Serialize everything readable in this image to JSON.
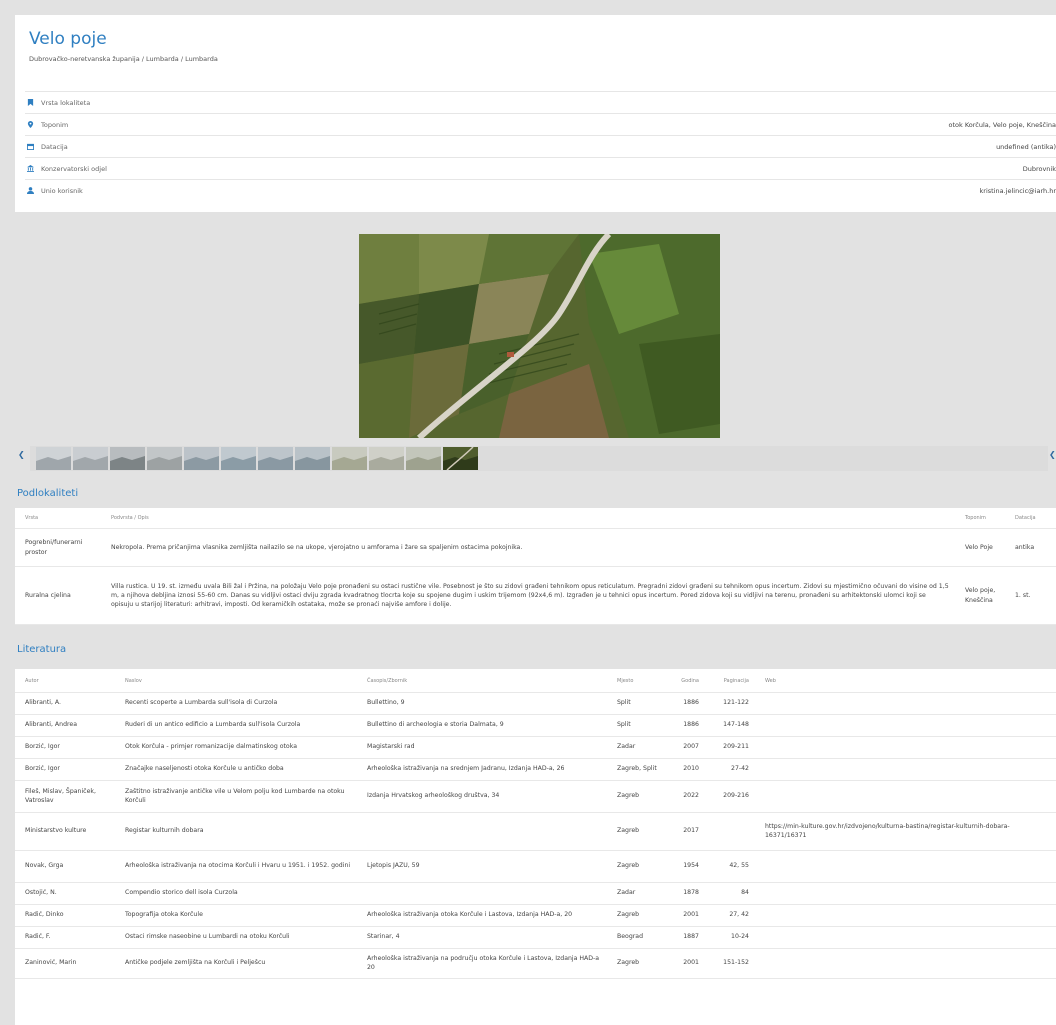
{
  "site": {
    "title": "Velo poje",
    "breadcrumb": "Dubrovačko-neretvanska županija / Lumbarda / Lumbarda"
  },
  "info": [
    {
      "icon": "bookmark-icon",
      "label": "Vrsta lokaliteta",
      "value": ""
    },
    {
      "icon": "map-marker-icon",
      "label": "Toponim",
      "value": "otok Korčula, Velo poje, Kneščina"
    },
    {
      "icon": "calendar-icon",
      "label": "Datacija",
      "value": "undefined (antika)"
    },
    {
      "icon": "institution-icon",
      "label": "Konzervatorski odjel",
      "value": "Dubrovnik"
    },
    {
      "icon": "user-icon",
      "label": "Unio korisnik",
      "value": "kristina.jelincic@iarh.hr"
    }
  ],
  "colors": {
    "accent": "#2f7fc1",
    "background": "#e2e2e2"
  },
  "gallery": {
    "prev_icon": "chevron-left-icon",
    "next_icon": "chevron-right-icon",
    "nav_prev": "❮",
    "nav_next": "❮",
    "thumb_count": 12
  },
  "sections": {
    "subsites": "Podlokaliteti",
    "literature": "Literatura"
  },
  "subsites": {
    "columns": [
      "Vrsta",
      "Podvrsta / Opis",
      "Toponim",
      "Datacija"
    ],
    "rows": [
      {
        "type": "Pogrebni/funerarni prostor",
        "description": "Nekropola. Prema pričanjima vlasnika zemljišta nailazilo se na ukope, vjerojatno u amforama i žare sa spaljenim ostacima pokojnika.",
        "toponym": "Velo Poje",
        "dating": "antika"
      },
      {
        "type": "Ruralna cjelina",
        "description": "Villa rustica. U 19. st. između uvala Bili žal i Pržina, na položaju Velo poje pronađeni su ostaci rustične vile. Posebnost je što su zidovi građeni tehnikom opus reticulatum. Pregradni zidovi građeni su tehnikom opus incertum. Zidovi su mjestimično očuvani do visine od 1,5 m, a njihova debljina iznosi 55-60 cm. Danas su vidljivi ostaci dviju zgrada kvadratnog tlocrta koje su spojene dugim i uskim trijemom (92x4,6 m). Izgrađen je u tehnici opus incertum. Pored zidova koji su vidljivi na terenu, pronađeni su arhitektonski ulomci koji se opisuju u starijoj literaturi: arhitravi, imposti. Od keramičkih ostataka, može se pronaći najviše amfore i dolije.",
        "toponym": "Velo poje, Kneščina",
        "dating": "1. st."
      }
    ]
  },
  "literature": {
    "columns": [
      "Autor",
      "Naslov",
      "Časopis/Zbornik",
      "Mjesto",
      "Godina",
      "Paginacija",
      "Web"
    ],
    "rows": [
      {
        "author": "Alibranti, A.",
        "title": "Recenti scoperte a Lumbarda sull'isola di Curzola",
        "journal": "Bullettino, 9",
        "place": "Split",
        "year": "1886",
        "pages": "121-122",
        "web": ""
      },
      {
        "author": "Alibranti, Andrea",
        "title": "Ruderi di un antico edificio a Lumbarda sull'isola Curzola",
        "journal": "Bullettino di archeologia e storia Dalmata, 9",
        "place": "Split",
        "year": "1886",
        "pages": "147-148",
        "web": ""
      },
      {
        "author": "Borzić, Igor",
        "title": "Otok Korčula - primjer romanizacije dalmatinskog otoka",
        "journal": "Magistarski rad",
        "place": "Zadar",
        "year": "2007",
        "pages": "209-211",
        "web": ""
      },
      {
        "author": "Borzić, Igor",
        "title": "Značajke naseljenosti otoka Korčule u antičko doba",
        "journal": "Arheološka istraživanja na srednjem Jadranu, Izdanja HAD-a, 26",
        "place": "Zagreb, Split",
        "year": "2010",
        "pages": "27-42",
        "web": ""
      },
      {
        "author": "Fileš, Mislav, Španiček, Vatroslav",
        "title": "Zaštitno istraživanje antičke vile u Velom polju kod Lumbarde na otoku Korčuli",
        "journal": "Izdanja Hrvatskog arheološkog društva, 34",
        "place": "Zagreb",
        "year": "2022",
        "pages": "209-216",
        "web": ""
      },
      {
        "author": "Ministarstvo kulture",
        "title": "Registar kulturnih dobara",
        "journal": "",
        "place": "Zagreb",
        "year": "2017",
        "pages": "",
        "web": "https://min-kulture.gov.hr/izdvojeno/kulturna-bastina/registar-kulturnih-dobara-16371/16371"
      },
      {
        "author": "Novak, Grga",
        "title": "Arheološka istraživanja na otocima Korčuli i Hvaru u 1951. i 1952. godini",
        "journal": "Ljetopis JAZU, 59",
        "place": "Zagreb",
        "year": "1954",
        "pages": "42, 55",
        "web": ""
      },
      {
        "author": "Ostojić, N.",
        "title": "Compendio storico dell isola Curzola",
        "journal": "",
        "place": "Zadar",
        "year": "1878",
        "pages": "84",
        "web": ""
      },
      {
        "author": "Radić, Dinko",
        "title": "Topografija otoka Korčule",
        "journal": "Arheološka istraživanja otoka Korčule i Lastova, Izdanja HAD-a, 20",
        "place": "Zagreb",
        "year": "2001",
        "pages": "27, 42",
        "web": ""
      },
      {
        "author": "Radić, F.",
        "title": "Ostaci rimske naseobine u Lumbardi na otoku Korčuli",
        "journal": "Starinar, 4",
        "place": "Beograd",
        "year": "1887",
        "pages": "10-24",
        "web": ""
      },
      {
        "author": "Zaninović, Marin",
        "title": "Antičke podjele zemljišta na Korčuli i Pelješcu",
        "journal": "Arheološka istraživanja na području otoka Korčule i Lastova, Izdanja HAD-a 20",
        "place": "Zagreb",
        "year": "2001",
        "pages": "151-152",
        "web": ""
      }
    ]
  }
}
